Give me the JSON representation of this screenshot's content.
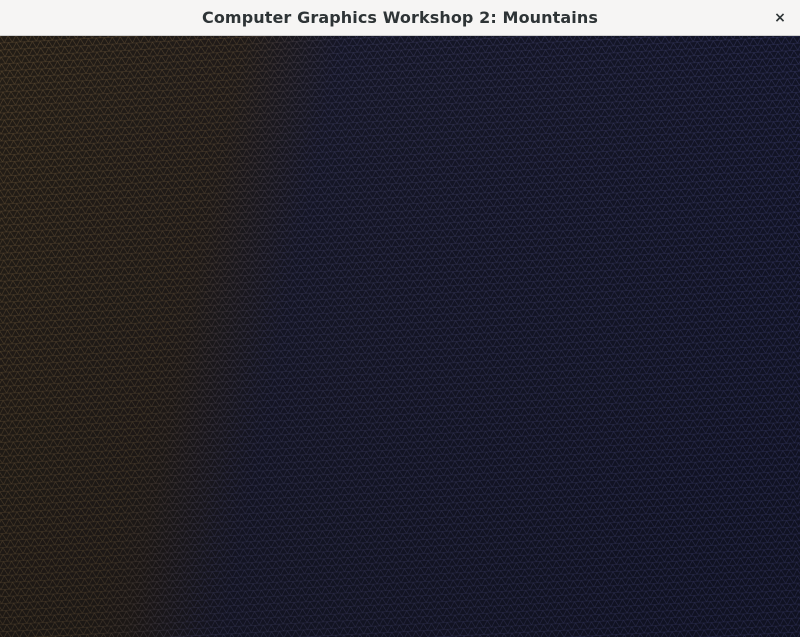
{
  "window": {
    "title": "Computer Graphics Workshop 2: Mountains",
    "close_glyph": "×",
    "close_icon": "close-icon"
  },
  "render": {
    "description_type": "wireframe-terrain-mesh",
    "colors": {
      "warm_mesh": "#9a7a4e",
      "cool_mesh": "#5a5c9a",
      "background_warm": "#221d17",
      "background_cool": "#131528"
    }
  }
}
